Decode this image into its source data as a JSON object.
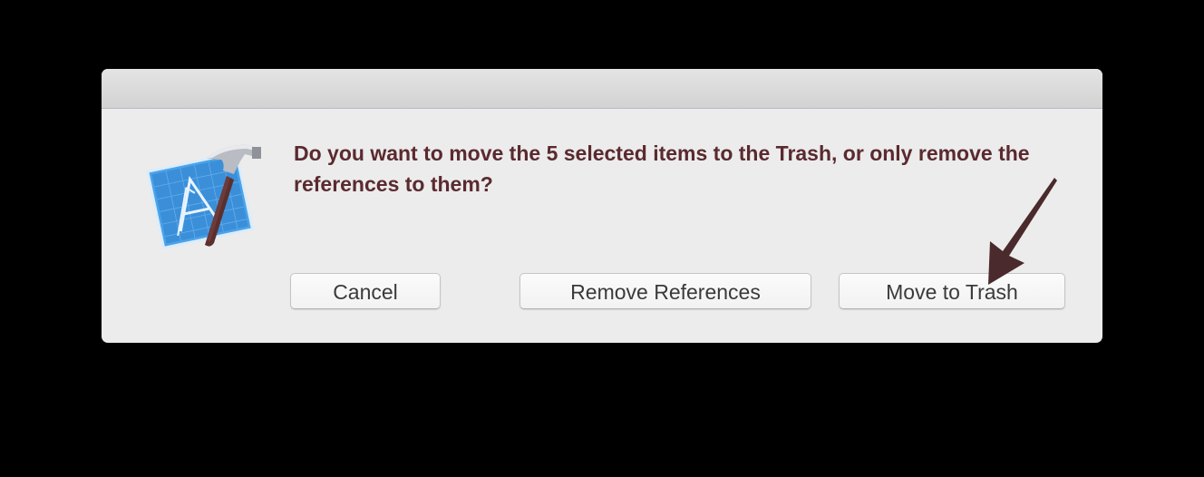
{
  "dialog": {
    "message": "Do you want to move the 5 selected items to the Trash, or only remove the references to them?",
    "app_icon": "xcode-icon",
    "buttons": {
      "cancel": "Cancel",
      "remove_references": "Remove References",
      "move_to_trash": "Move to Trash"
    }
  },
  "colors": {
    "message_text": "#5a2a2f",
    "dialog_background": "#ececec",
    "annotation_arrow": "#4a2a2c",
    "icon_blue": "#3b8fd9"
  }
}
